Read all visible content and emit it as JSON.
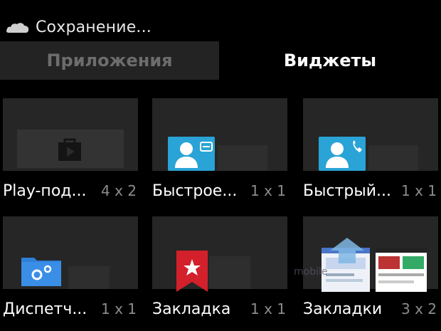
{
  "status": {
    "text": "Сохранение...",
    "icon": "cloud-icon"
  },
  "tabs": {
    "apps": "Приложения",
    "widgets": "Виджеты"
  },
  "widgets": [
    {
      "name": "Play-под...",
      "size": "4 x 2",
      "icon": "play-store-bag-icon"
    },
    {
      "name": "Быстрое...",
      "size": "1 x 1",
      "icon": "contact-message-icon"
    },
    {
      "name": "Быстрый...",
      "size": "1 x 1",
      "icon": "contact-call-icon"
    },
    {
      "name": "Диспетч...",
      "size": "1 x 1",
      "icon": "file-manager-settings-icon"
    },
    {
      "name": "Закладка",
      "size": "1 x 1",
      "icon": "bookmark-star-icon"
    },
    {
      "name": "Закладки",
      "size": "3 x 2",
      "icon": "bookmarks-thumbnails-icon"
    }
  ],
  "watermark": "mobile",
  "colors": {
    "contact_blue": "#2aa3d6",
    "bookmark_red": "#d3202b",
    "folder_blue": "#2f7fd6",
    "tab_inactive_bg": "#232323"
  }
}
